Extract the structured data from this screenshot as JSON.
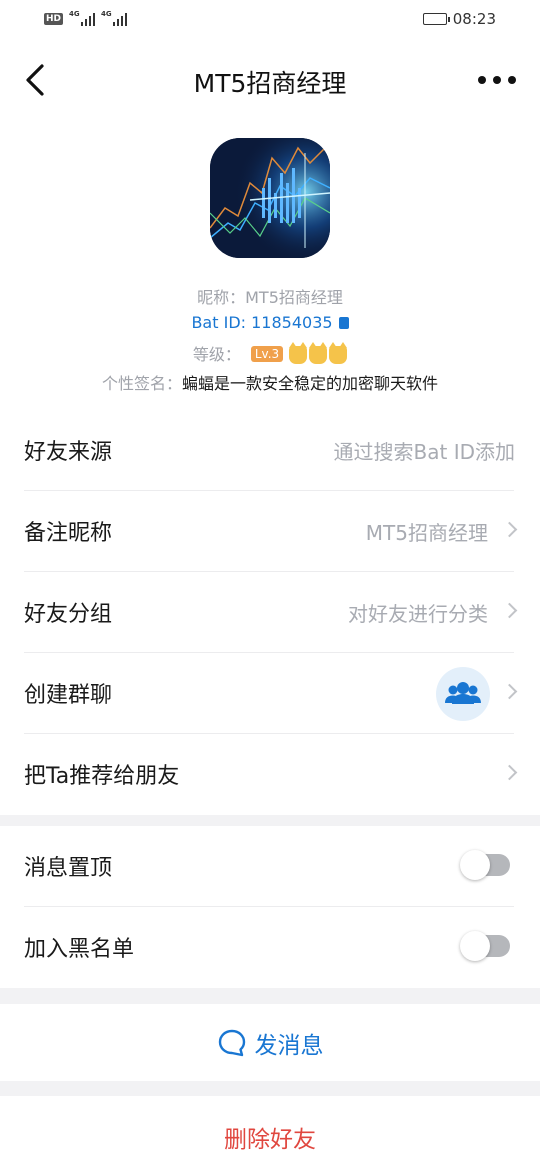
{
  "status_bar": {
    "hd_label": "HD",
    "signal_label_1": "4G",
    "signal_label_2": "4G",
    "time": "08:23"
  },
  "header": {
    "title": "MT5招商经理",
    "back_icon": "chevron-left-icon",
    "more_icon": "more-dots-icon"
  },
  "profile": {
    "avatar_icon": "stock-chart-avatar",
    "nickname_label": "昵称：",
    "nickname": "MT5招商经理",
    "bat_id_label": "Bat ID: ",
    "bat_id": "11854035",
    "level_label": "等级：",
    "level_badge": "Lv.3",
    "signature_label": "个性签名：",
    "signature": "蝙蝠是一款安全稳定的加密聊天软件"
  },
  "rows": [
    {
      "label": "好友来源",
      "value": "通过搜索Bat ID添加"
    },
    {
      "label": "备注昵称",
      "value": "MT5招商经理"
    },
    {
      "label": "好友分组",
      "value": "对好友进行分类"
    },
    {
      "label": "创建群聊",
      "value": ""
    },
    {
      "label": "把Ta推荐给朋友",
      "value": ""
    }
  ],
  "toggles": [
    {
      "label": "消息置顶",
      "on": false
    },
    {
      "label": "加入黑名单",
      "on": false
    }
  ],
  "actions": {
    "send_label": "发消息",
    "delete_label": "删除好友"
  },
  "colors": {
    "accent": "#1976d2",
    "danger": "#e0473f",
    "level_badge": "#f0a04b"
  }
}
